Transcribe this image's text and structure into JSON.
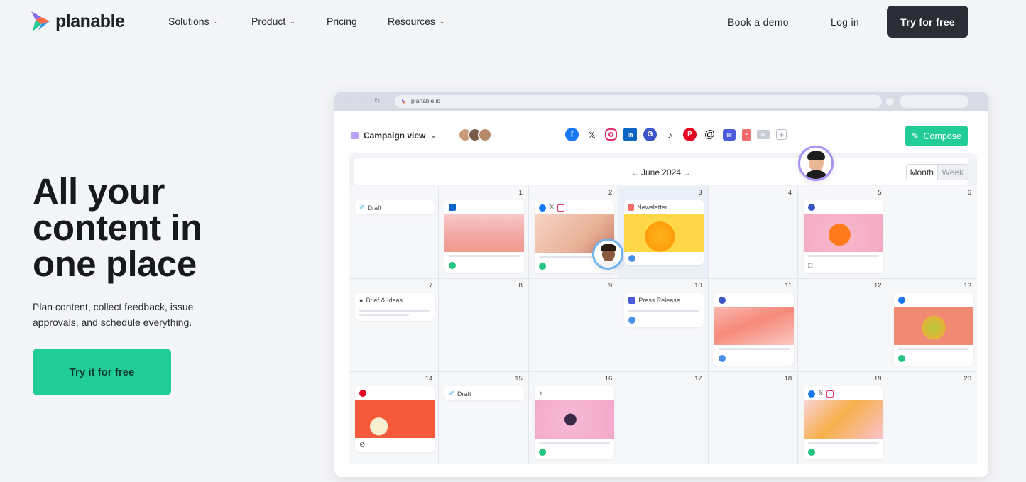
{
  "nav": {
    "brand": "planable",
    "items": [
      {
        "label": "Solutions",
        "dropdown": true
      },
      {
        "label": "Product",
        "dropdown": true
      },
      {
        "label": "Pricing",
        "dropdown": false
      },
      {
        "label": "Resources",
        "dropdown": true
      }
    ],
    "book_demo": "Book a demo",
    "login": "Log in",
    "try_free": "Try for free"
  },
  "hero": {
    "title": "All your content in one place",
    "subtitle": "Plan content, collect feedback, issue approvals, and schedule everything.",
    "cta": "Try it for free"
  },
  "mock": {
    "url": "planable.io",
    "view_label": "Campaign view",
    "compose": "Compose",
    "month": "June 2024",
    "toggle": [
      "Month",
      "Week"
    ],
    "channels": [
      "facebook-icon",
      "x-icon",
      "instagram-icon",
      "linkedin-icon",
      "google-icon",
      "tiktok-icon",
      "pinterest-icon",
      "threads-icon",
      "press-icon",
      "document-icon",
      "email-icon",
      "add-channel-icon"
    ],
    "days": [
      "",
      "1",
      "2",
      "3",
      "4",
      "5",
      "6",
      "7",
      "8",
      "9",
      "10",
      "11",
      "12",
      "13",
      "14",
      "15",
      "16",
      "17",
      "18",
      "19",
      "20"
    ],
    "cards": {
      "draft": "Draft",
      "newsletter": "Newsletter",
      "brief": "Brief & Ideas",
      "press": "Press Release",
      "draft2": "Draft"
    }
  },
  "colors": {
    "accent": "#22cc96",
    "dark_button": "#2b2e36",
    "avatar_ring": "#a991f5"
  }
}
